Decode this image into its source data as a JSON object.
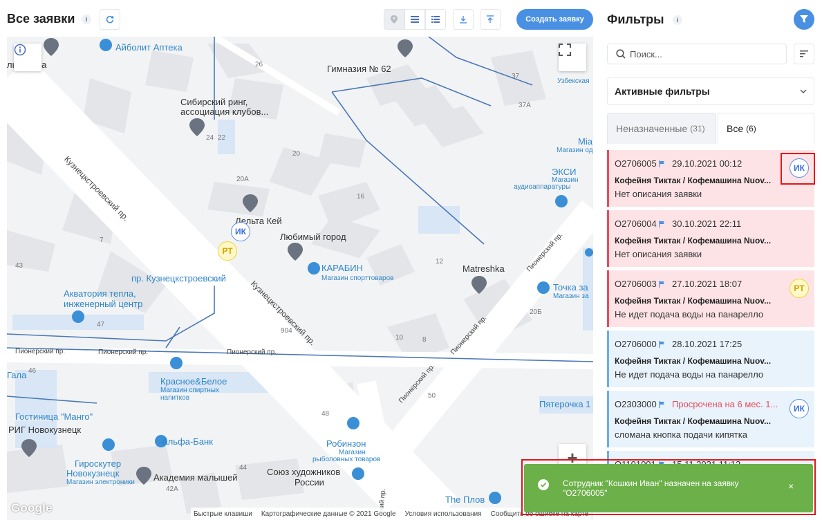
{
  "header": {
    "title": "Все заявки",
    "info_icon": "i",
    "create_label": "Создать заявку",
    "view_icons": [
      "map-pin-icon",
      "list-icon",
      "details-list-icon"
    ],
    "tool_icons": [
      "refresh-icon",
      "download-icon",
      "upload-icon"
    ]
  },
  "map": {
    "labels": {
      "aibolit": "Айболит Аптека",
      "gorba": "льборьба",
      "gymnasium": "Гимназия № 62",
      "uzbek": "Узбекская",
      "sib_ring_1": "Сибирский ринг,",
      "sib_ring_2": "ассоциация клубов...",
      "kuz_street_1": "Кузнецкстроевский пр.",
      "kuz_street_2": "Кузнецкстроевский пр.",
      "mia": "Mia",
      "mia_sub": "Магазин од",
      "eksi": "ЭКСИ",
      "eksi_sub_1": "Магазин",
      "eksi_sub_2": "аудиоаппаратуры",
      "delta": "Дельта Кей",
      "lubimy": "Любимый город",
      "karabin": "КАРАБИН",
      "karabin_sub": "Магазин спорттоваров",
      "matreshka": "Matreshka",
      "pionersky_1": "Пионерский пр.",
      "pionersky_2": "Пионерский пр.",
      "pionersky_3": "Пионерский пр.",
      "pionersky_4": "Пионерский пр.",
      "pionersky_5": "Пионерский пр.",
      "pionersky_6": "Пионерский пр.",
      "tochka": "Точка за",
      "tochka_sub": "Магазин за",
      "kuz_stop": "пр. Кузнецкстроевский",
      "akvatoria_1": "Акватория тепла,",
      "akvatoria_2": "инженерный центр",
      "gala": "Гала",
      "krasnoe": "Красное&Белое",
      "krasnoe_sub_1": "Магазин спиртных",
      "krasnoe_sub_2": "напитков",
      "pyaterochka": "Пятерочка 1",
      "hotel": "Гостиница \"Манго\"",
      "rig": "РИГ Новокузнецк",
      "alfa": "Альфа-Банк",
      "robinzon": "Робинзон",
      "robinzon_sub_1": "Магазин",
      "robinzon_sub_2": "рыболовных товаров",
      "giro_1": "Гироскутер",
      "giro_2": "Новокузнецк",
      "giro_sub": "Магазин электроники",
      "academy": "Академия малышей",
      "artists_1": "Союз художников",
      "artists_2": "России",
      "plov": "The Плов",
      "sky_street": "ский пр."
    },
    "buildings": [
      "26",
      "37",
      "37A",
      "24",
      "22",
      "20",
      "20A",
      "16",
      "7",
      "43",
      "12",
      "47",
      "20Б",
      "904",
      "10",
      "8",
      "46",
      "50",
      "48",
      "44",
      "42A"
    ],
    "markers": [
      {
        "id": "ik",
        "label": "ИК"
      },
      {
        "id": "rt",
        "label": "РТ"
      }
    ],
    "footer": [
      "Быстрые клавиши",
      "Картографические данные © 2021 Google",
      "Условия использования",
      "Сообщить об ошибке на карте"
    ],
    "logo": "Google",
    "zoom_in": "+"
  },
  "filters": {
    "title": "Фильтры",
    "info_icon": "i",
    "search_placeholder": "Поиск...",
    "active_filters_label": "Активные фильтры",
    "tabs": [
      {
        "label": "Неназначенные",
        "count": "(31)"
      },
      {
        "label": "Все",
        "count": "(6)"
      }
    ]
  },
  "tickets": [
    {
      "number": "O2706005",
      "date": "29.10.2021 00:12",
      "title": "Кофейня Тиктак / Кофемашина Nuov...",
      "description": "Нет описания заявки",
      "assignee": "ИК",
      "style": "pink"
    },
    {
      "number": "O2706004",
      "date": "30.10.2021 22:11",
      "title": "Кофейня Тиктак / Кофемашина Nuov...",
      "description": "Нет описания заявки",
      "assignee": "",
      "style": "pink"
    },
    {
      "number": "O2706003",
      "date": "27.10.2021 18:07",
      "title": "Кофейня Тиктак / Кофемашина Nuov...",
      "description": "Не идет подача воды на панарелло",
      "assignee": "РТ",
      "style": "pink"
    },
    {
      "number": "O2706000",
      "date": "28.10.2021 17:25",
      "title": "Кофейня Тиктак / Кофемашина Nuov...",
      "description": "Не идет подача воды на панарелло",
      "assignee": "",
      "style": "blue"
    },
    {
      "number": "O2303000",
      "date": "Просрочена на 6 мес. 1...",
      "title": "Кофейня Тиктак / Кофемашина Nuov...",
      "description": "сломана кнопка подачи кипятка",
      "assignee": "ИК",
      "style": "blue"
    },
    {
      "number": "O1101001",
      "date": "15.11.2021 11:12",
      "title": "",
      "description": "",
      "assignee": "",
      "style": "blue"
    }
  ],
  "toast": {
    "message": "Сотрудник \"Кошкин Иван\" назначен на заявку \"O2706005\"",
    "close": "×"
  },
  "colors": {
    "accent": "#4a90e2",
    "toast": "#6cb049",
    "overdue": "#e74c5c",
    "highlight": "#e1161c"
  }
}
